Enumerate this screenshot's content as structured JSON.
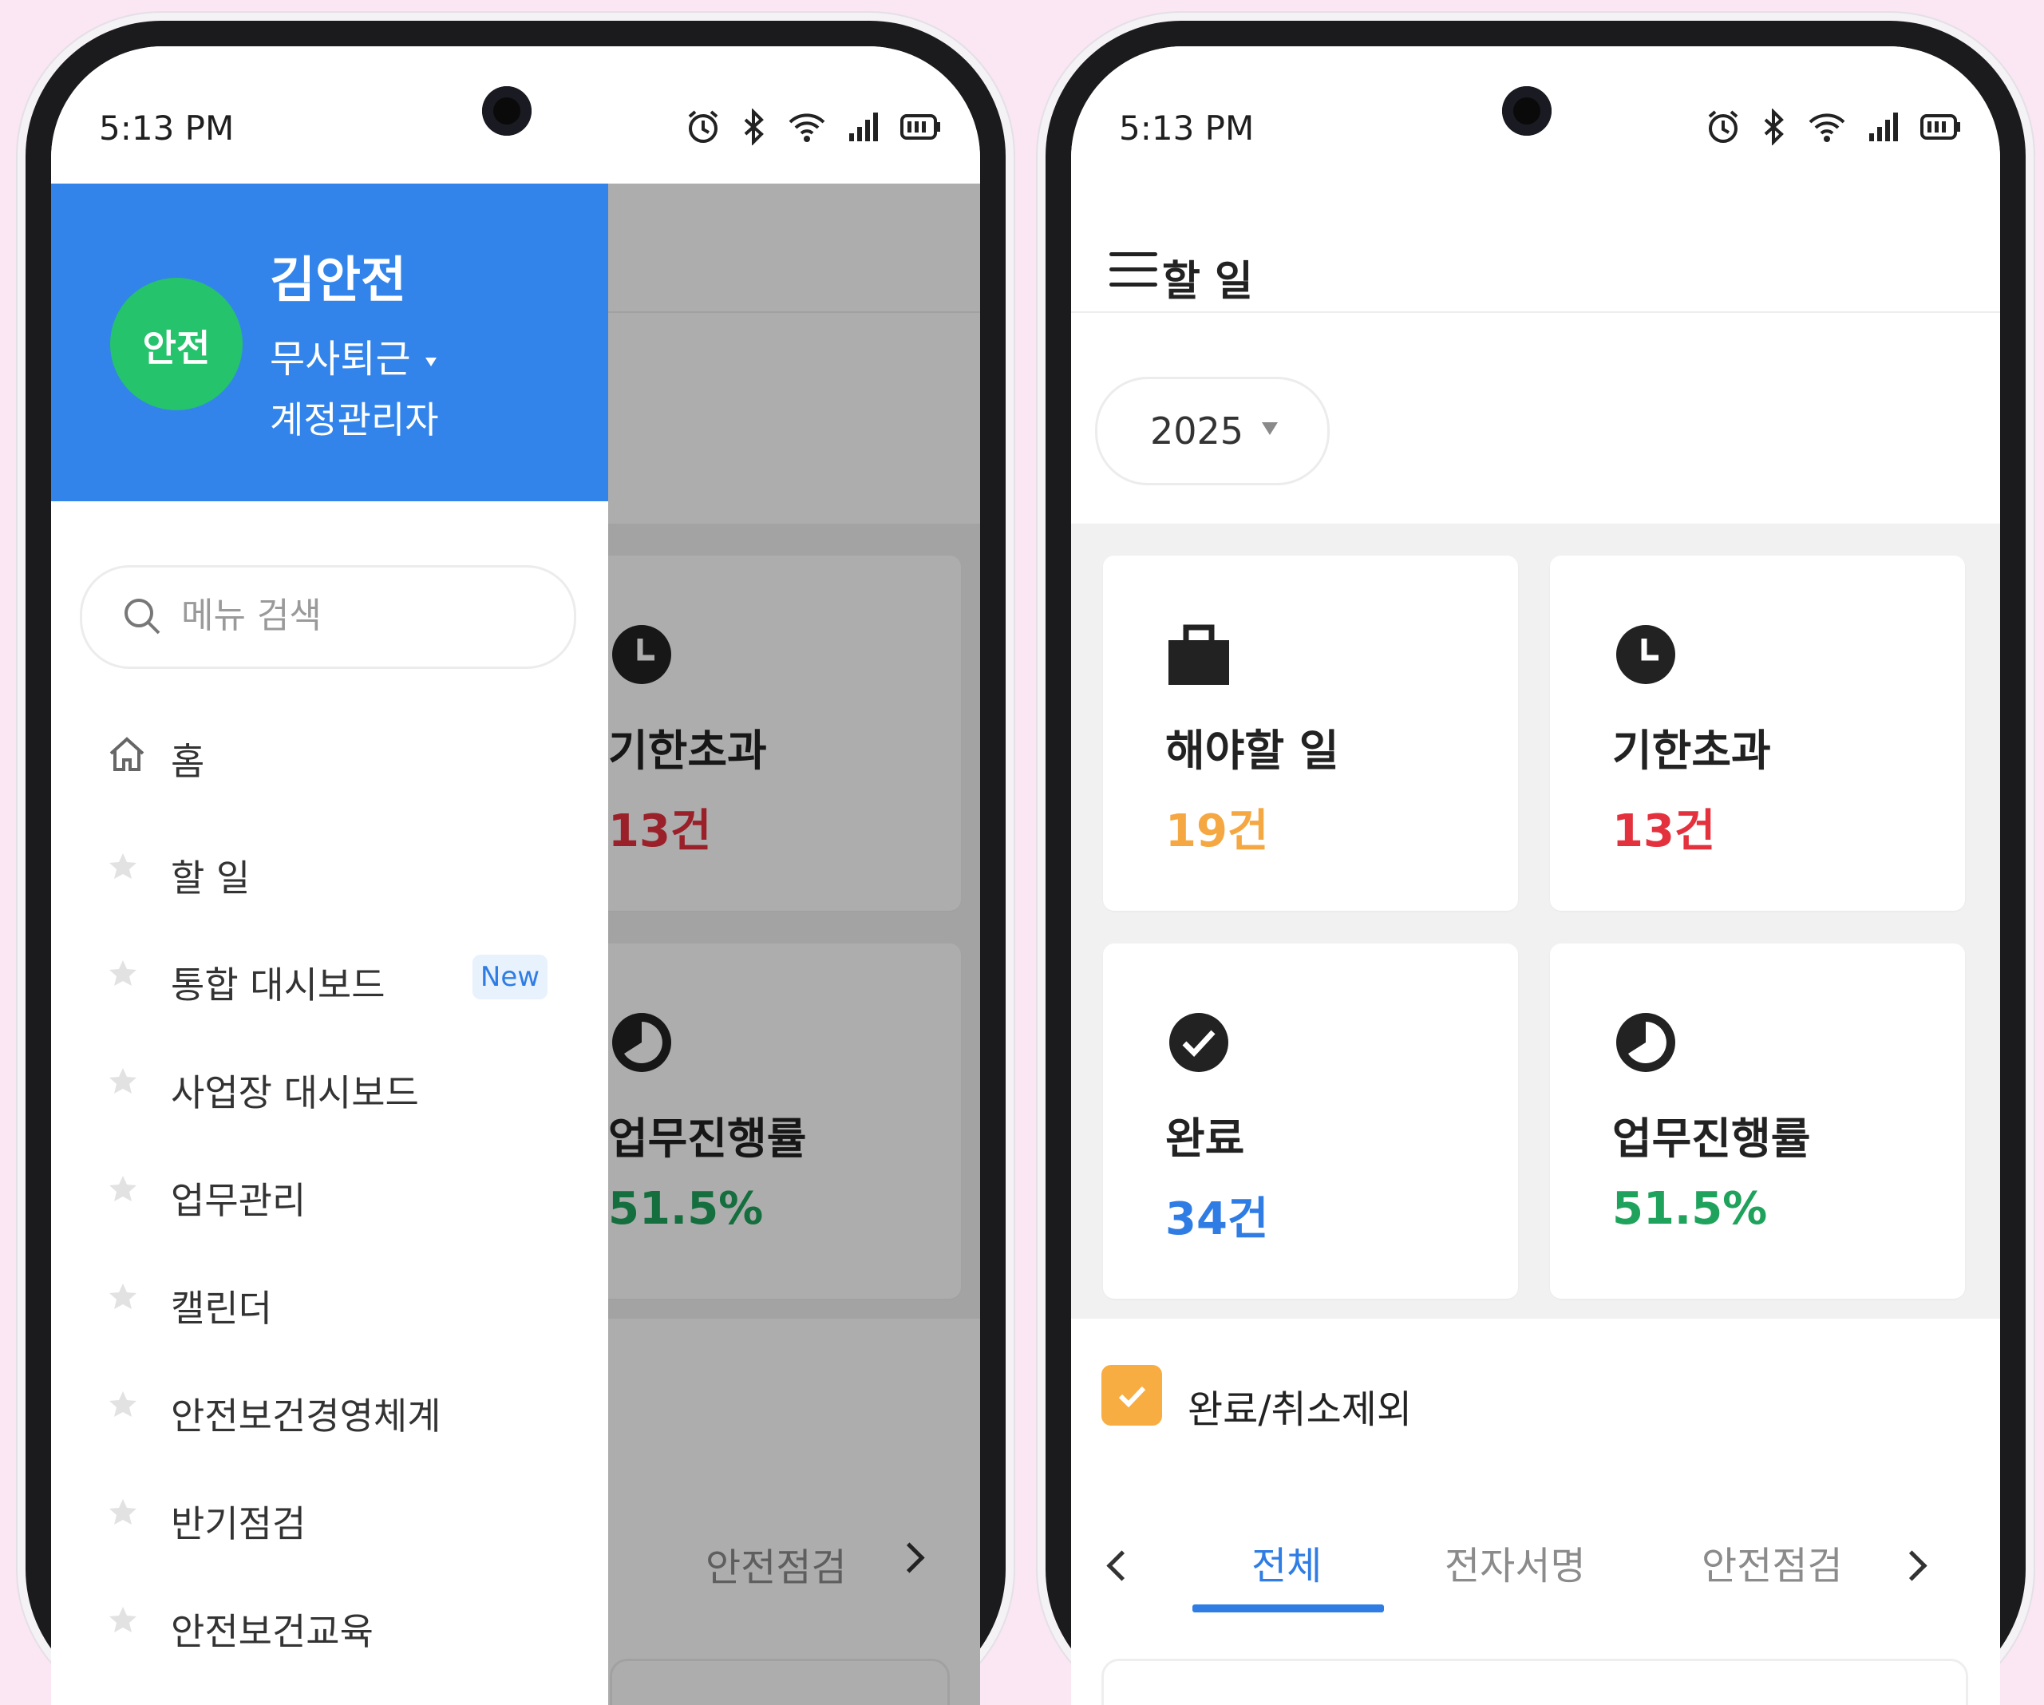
{
  "status_bar": {
    "time": "5:13 PM"
  },
  "drawer": {
    "avatar_text": "안전",
    "user_name": "김안전",
    "user_status": "무사퇴근",
    "user_role": "계정관리자",
    "search_placeholder": "메뉴 검색",
    "items": [
      {
        "label": "홈",
        "icon": "home-icon"
      },
      {
        "label": "할 일",
        "icon": "star-icon"
      },
      {
        "label": "통합 대시보드",
        "icon": "star-icon",
        "badge": "New"
      },
      {
        "label": "사업장 대시보드",
        "icon": "star-icon"
      },
      {
        "label": "업무관리",
        "icon": "star-icon"
      },
      {
        "label": "캘린더",
        "icon": "star-icon"
      },
      {
        "label": "안전보건경영체계",
        "icon": "star-icon"
      },
      {
        "label": "반기점검",
        "icon": "star-icon"
      },
      {
        "label": "안전보건교육",
        "icon": "star-icon"
      }
    ]
  },
  "underlay": {
    "overdue_title": "기한초과",
    "overdue_value": "13건",
    "progress_title": "업무진행률",
    "progress_value": "51.5%",
    "tab_peek": "안전점검"
  },
  "todo": {
    "title": "할 일",
    "year": "2025",
    "cards": [
      {
        "title": "해야할 일",
        "value": "19건",
        "icon": "briefcase-icon",
        "color": "#f5a742"
      },
      {
        "title": "기한초과",
        "value": "13건",
        "icon": "clock-icon",
        "color": "#e3323d"
      },
      {
        "title": "완료",
        "value": "34건",
        "icon": "check-circle-icon",
        "color": "#2f7de4"
      },
      {
        "title": "업무진행률",
        "value": "51.5%",
        "icon": "pie-progress-icon",
        "color": "#1fa35c"
      }
    ],
    "exclude_label": "완료/취소제외",
    "exclude_checked": true,
    "tabs": [
      {
        "label": "전체",
        "active": true
      },
      {
        "label": "전자서명",
        "active": false
      },
      {
        "label": "안전점검",
        "active": false
      }
    ]
  },
  "colors": {
    "primary": "#3384ea",
    "avatar": "#25c36c",
    "checkbox": "#f7ad42"
  }
}
